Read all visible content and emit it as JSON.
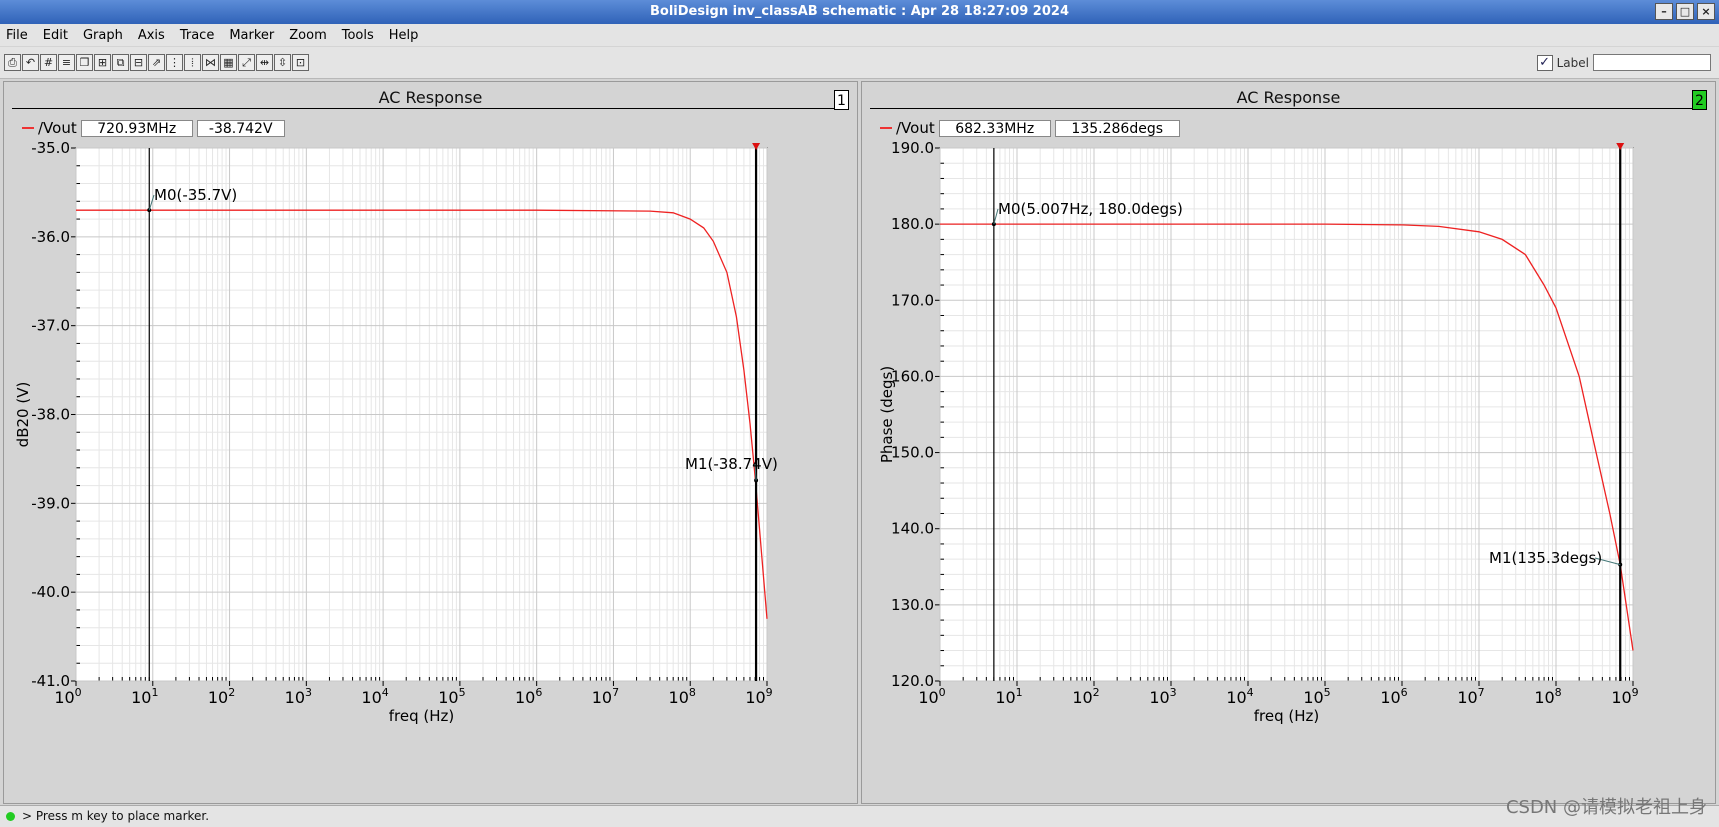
{
  "window": {
    "title": "BoliDesign inv_classAB schematic : Apr 28 18:27:09 2024",
    "btn_min": "–",
    "btn_max": "□",
    "btn_close": "×"
  },
  "menu": [
    "File",
    "Edit",
    "Graph",
    "Axis",
    "Trace",
    "Marker",
    "Zoom",
    "Tools",
    "Help"
  ],
  "toolbar": {
    "label_text": "Label",
    "label_checked": "✓",
    "label_value": ""
  },
  "panels": [
    {
      "title": "AC Response",
      "number": "1",
      "number_bg": "#ffffff",
      "trace": "/Vout",
      "readout_x": "720.93MHz",
      "readout_y": "-38.742V",
      "ylabel": "dB20 (V)",
      "xlabel": "freq (Hz)"
    },
    {
      "title": "AC Response",
      "number": "2",
      "number_bg": "#22cc22",
      "trace": "/Vout",
      "readout_x": "682.33MHz",
      "readout_y": "135.286degs",
      "ylabel": "Phase (degs)",
      "xlabel": "freq (Hz)"
    }
  ],
  "chart_data": [
    {
      "type": "line",
      "title": "AC Response",
      "xlabel": "freq (Hz)",
      "ylabel": "dB20 (V)",
      "xscale": "log",
      "xlim": [
        1,
        1000000000
      ],
      "ylim": [
        -41.0,
        -35.0
      ],
      "yticks": [
        "-35.0",
        "-36.0",
        "-37.0",
        "-38.0",
        "-39.0",
        "-40.0",
        "-41.0"
      ],
      "xticks": [
        "0",
        "1",
        "2",
        "3",
        "4",
        "5",
        "6",
        "7",
        "8",
        "9"
      ],
      "series": [
        {
          "name": "/Vout",
          "color": "#ee2222",
          "x": [
            1,
            10,
            1000000,
            30000000,
            60000000,
            100000000,
            150000000,
            200000000,
            300000000,
            400000000,
            500000000,
            600000000,
            700000000,
            800000000,
            1000000000
          ],
          "y": [
            -35.7,
            -35.7,
            -35.7,
            -35.71,
            -35.73,
            -35.8,
            -35.9,
            -36.05,
            -36.4,
            -36.9,
            -37.5,
            -38.1,
            -38.7,
            -39.3,
            -40.3
          ]
        }
      ],
      "markers": [
        {
          "label": "M0(-35.7V)",
          "x": 9,
          "y": -35.7
        },
        {
          "label": "M1(-38.74V)",
          "x": 720930000,
          "y": -38.742
        }
      ],
      "grid": true
    },
    {
      "type": "line",
      "title": "AC Response",
      "xlabel": "freq (Hz)",
      "ylabel": "Phase (degs)",
      "xscale": "log",
      "xlim": [
        1,
        1000000000
      ],
      "ylim": [
        120.0,
        190.0
      ],
      "yticks": [
        "190.0",
        "180.0",
        "170.0",
        "160.0",
        "150.0",
        "140.0",
        "130.0",
        "120.0"
      ],
      "xticks": [
        "0",
        "1",
        "2",
        "3",
        "4",
        "5",
        "6",
        "7",
        "8",
        "9"
      ],
      "series": [
        {
          "name": "/Vout",
          "color": "#ee2222",
          "x": [
            1,
            100000,
            1000000,
            3000000,
            10000000,
            20000000,
            40000000,
            70000000,
            100000000,
            200000000,
            300000000,
            500000000,
            682330000,
            1000000000
          ],
          "y": [
            180,
            180,
            179.9,
            179.7,
            179,
            178,
            176,
            172,
            169,
            160,
            152,
            142,
            135.3,
            124
          ]
        }
      ],
      "markers": [
        {
          "label": "M0(5.007Hz, 180.0degs)",
          "x": 5.007,
          "y": 180.0
        },
        {
          "label": "M1(135.3degs)",
          "x": 682330000,
          "y": 135.286
        }
      ],
      "grid": true
    }
  ],
  "status": {
    "text": "> Press m key to place marker."
  },
  "watermark": "CSDN @请模拟老祖上身"
}
